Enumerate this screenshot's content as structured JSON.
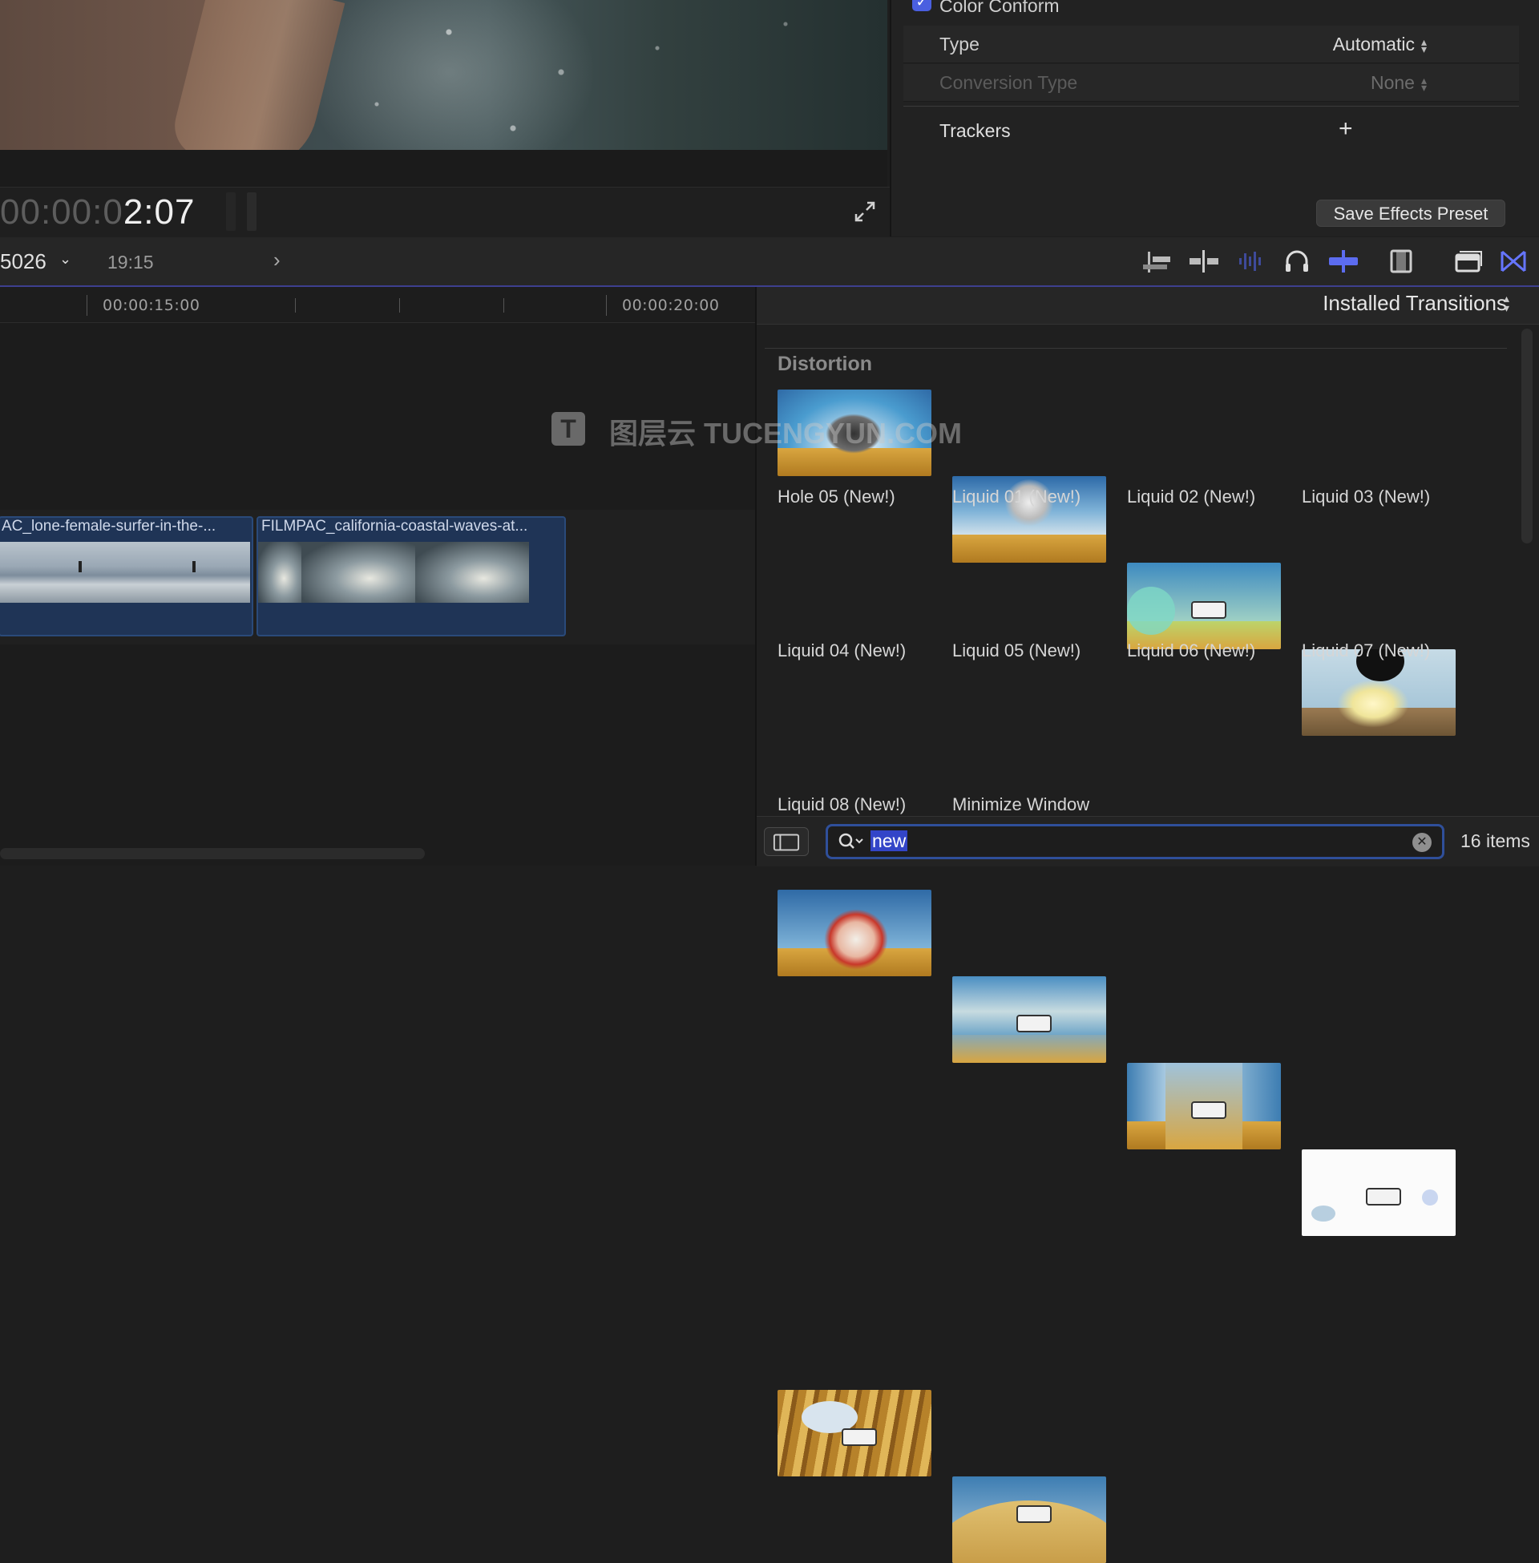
{
  "viewer": {
    "timecode_dim": "00:00:0",
    "timecode_bright": "2:07"
  },
  "inspector": {
    "color_conform": {
      "label": "Color Conform",
      "checked": true
    },
    "type": {
      "label": "Type",
      "value": "Automatic"
    },
    "conversion_type": {
      "label": "Conversion Type",
      "value": "None"
    },
    "trackers": {
      "label": "Trackers",
      "add": "+"
    },
    "save_preset_label": "Save Effects Preset"
  },
  "timeline": {
    "project_name": "5026",
    "duration": "19:15",
    "ruler": [
      "00:00:15:00",
      "00:00:20:00"
    ],
    "clips": [
      {
        "title": "AC_lone-female-surfer-in-the-..."
      },
      {
        "title": "FILMPAC_california-coastal-waves-at..."
      }
    ]
  },
  "toolbar_icons": [
    "append-clip-icon",
    "insert-clip-icon",
    "audio-waveform-icon",
    "headphones-icon",
    "snapping-icon",
    "clip-appearance-icon",
    "browser-toggle-icon",
    "transitions-browser-icon"
  ],
  "browser": {
    "collection": "Installed Transitions",
    "category": "Distortion",
    "items": [
      {
        "label": "Hole 05 (New!)"
      },
      {
        "label": "Liquid 01 (New!)"
      },
      {
        "label": "Liquid 02 (New!)"
      },
      {
        "label": "Liquid 03 (New!)"
      },
      {
        "label": "Liquid 04 (New!)"
      },
      {
        "label": "Liquid 05 (New!)"
      },
      {
        "label": "Liquid 06 (New!)"
      },
      {
        "label": "Liquid 07 (New!)"
      },
      {
        "label": "Liquid 08 (New!)"
      },
      {
        "label": "Minimize Window"
      }
    ],
    "search_value": "new",
    "item_count": "16 items"
  },
  "watermark": {
    "text": "图层云 TUCENGYUN.COM",
    "logo": "T"
  },
  "colors": {
    "accent_blue": "#4a5fe0",
    "selection_blue": "#3345c8",
    "clip_blue": "#1f3456",
    "timeline_divider": "#3d3f8f"
  }
}
